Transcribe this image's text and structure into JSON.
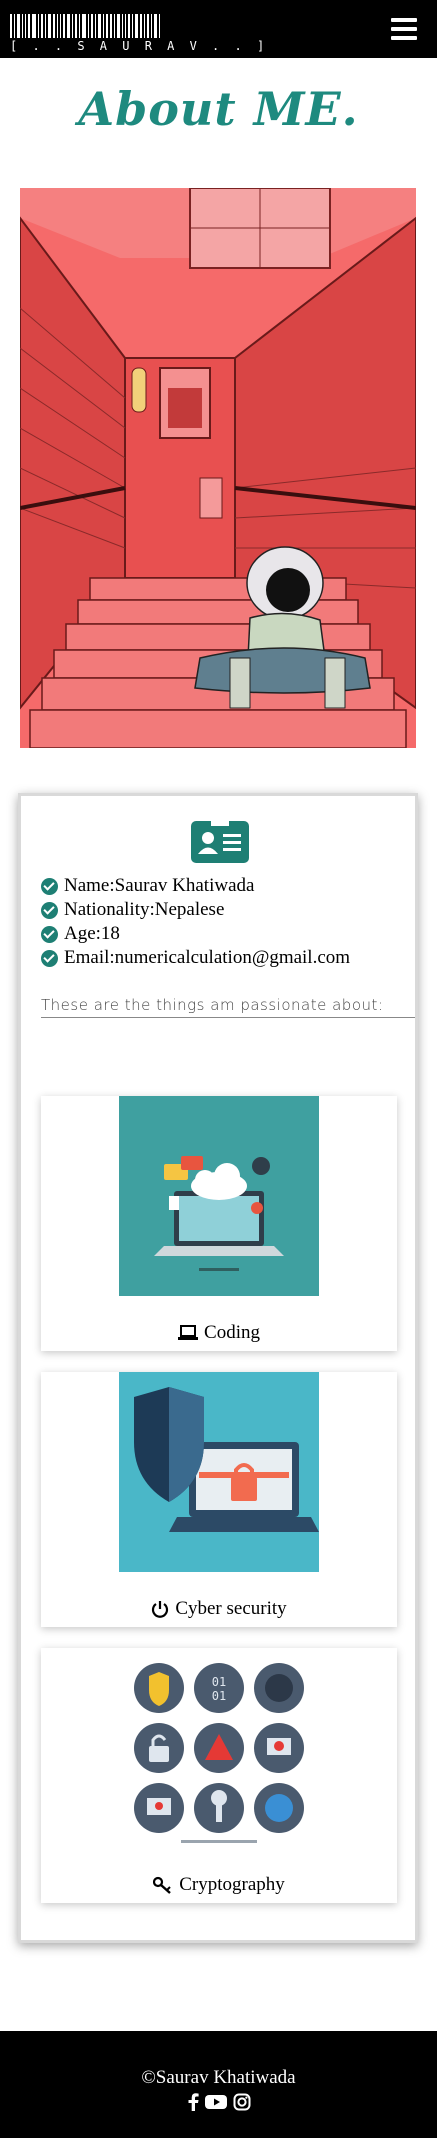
{
  "header": {
    "logo_text": "[ . . S A U R A V . . ]",
    "menu_icon": "hamburger-icon"
  },
  "page": {
    "title": "About ME."
  },
  "about": {
    "card_icon": "id-card-icon",
    "facts": [
      "Name:Saurav Khatiwada",
      "Nationality:Nepalese",
      "Age:18",
      "Email:numericalculation@gmail.com"
    ],
    "passion_text": "These are the things am passionate about:"
  },
  "skills": [
    {
      "label": "Coding",
      "icon": "laptop-icon"
    },
    {
      "label": "Cyber security",
      "icon": "power-icon"
    },
    {
      "label": "Cryptography",
      "icon": "key-icon"
    }
  ],
  "footer": {
    "copyright": "©Saurav Khatiwada",
    "social_icons": [
      "facebook-icon",
      "youtube-icon",
      "instagram-icon"
    ]
  },
  "colors": {
    "accent": "#1e8a7f",
    "hero_bg": "#f56b6b",
    "coding_bg": "#3fa0a0",
    "security_bg": "#4ab7c8"
  }
}
